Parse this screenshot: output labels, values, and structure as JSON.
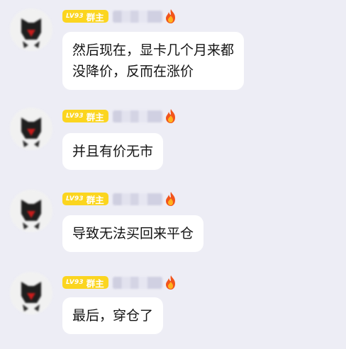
{
  "messages": [
    {
      "level": "LV93",
      "role": "群主",
      "name": "",
      "lines": [
        "然后现在，显卡几个月来都",
        "没降价，反而在涨价"
      ]
    },
    {
      "level": "LV93",
      "role": "群主",
      "name": "",
      "lines": [
        "并且有价无市"
      ]
    },
    {
      "level": "LV93",
      "role": "群主",
      "name": "",
      "lines": [
        "导致无法买回来平仓"
      ]
    },
    {
      "level": "LV93",
      "role": "群主",
      "name": "",
      "lines": [
        "最后，穿仓了"
      ]
    }
  ],
  "colors": {
    "background": "#ededf5",
    "badge": "#fbd51f",
    "bubble": "#ffffff",
    "text": "#141414"
  },
  "icons": {
    "avatar": "cartoon-avatar-icon",
    "flame": "flame-icon"
  }
}
